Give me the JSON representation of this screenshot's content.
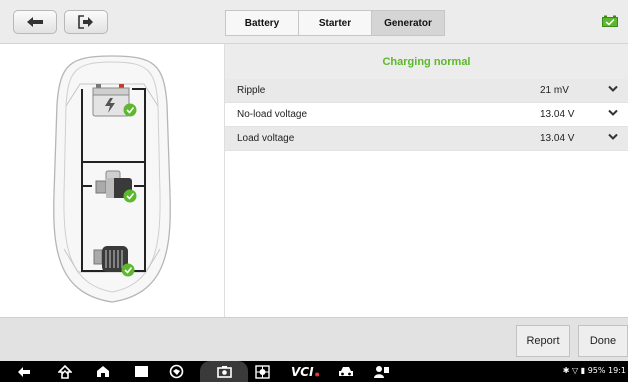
{
  "tabs": [
    {
      "label": "Battery",
      "active": false
    },
    {
      "label": "Starter",
      "active": false
    },
    {
      "label": "Generator",
      "active": true
    }
  ],
  "icons": {
    "back": "back-arrow-icon",
    "exit": "exit-icon",
    "battery_status": "battery-status-icon"
  },
  "diagram": {
    "components": [
      "battery",
      "starter",
      "generator"
    ],
    "status_icon": "check-circle-icon"
  },
  "results": {
    "status": "Charging normal",
    "status_color": "#5cb82c",
    "rows": [
      {
        "label": "Ripple",
        "value": "21 mV"
      },
      {
        "label": "No-load voltage",
        "value": "13.04 V"
      },
      {
        "label": "Load voltage",
        "value": "13.04 V"
      }
    ]
  },
  "actions": {
    "report": "Report",
    "done": "Done"
  },
  "sysbar": {
    "vci_label": "VCI",
    "status_text": "95% 19:1"
  },
  "colors": {
    "accent_green": "#5cb82c",
    "vci_error": "#e53935"
  }
}
